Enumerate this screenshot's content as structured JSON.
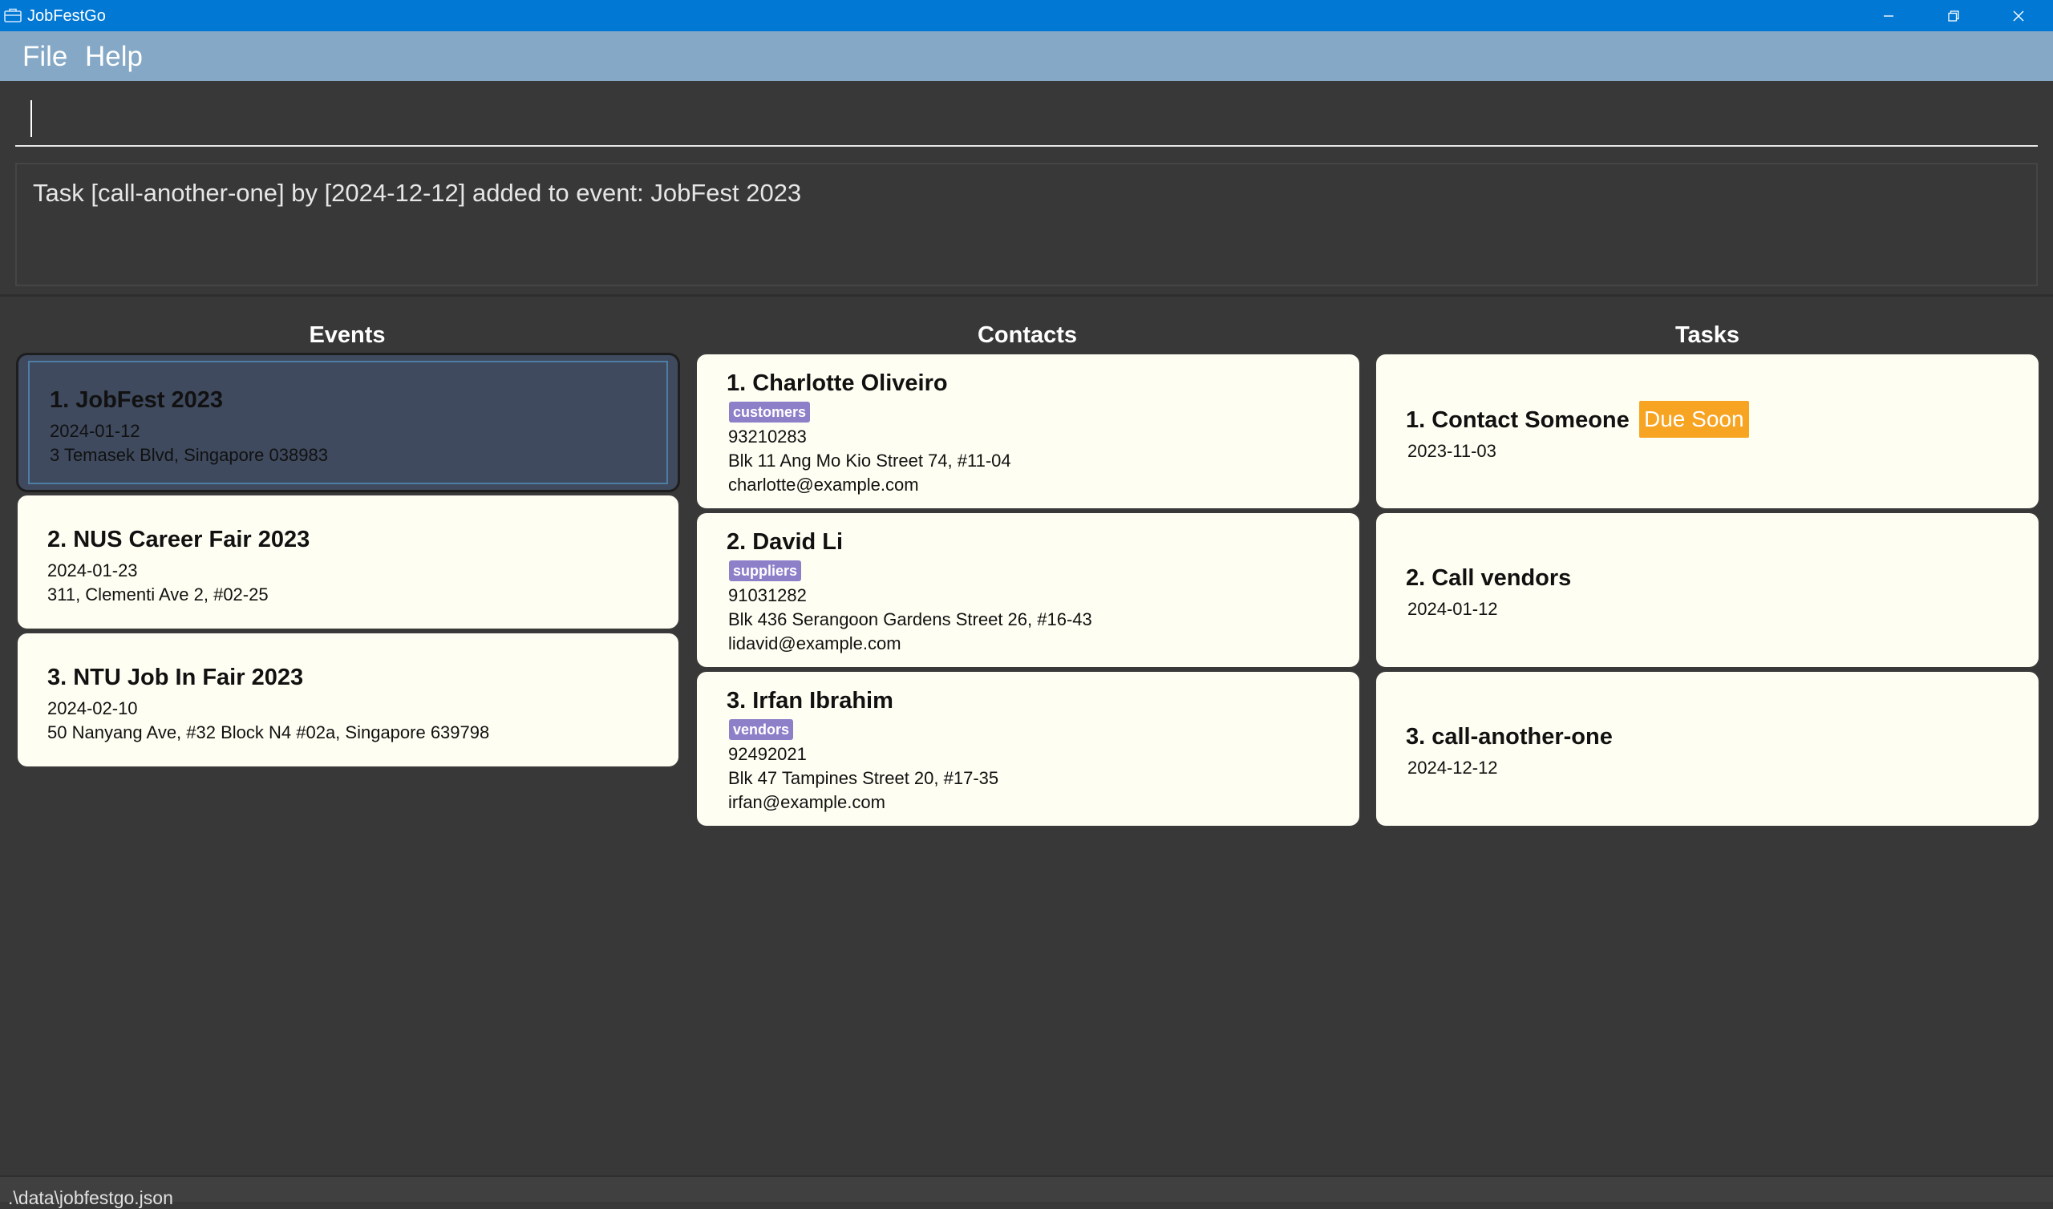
{
  "window": {
    "title": "JobFestGo"
  },
  "menu": {
    "file": "File",
    "help": "Help"
  },
  "command": {
    "value": ""
  },
  "result": {
    "text": "Task [call-another-one] by [2024-12-12] added to event: JobFest 2023"
  },
  "columns": {
    "events": "Events",
    "contacts": "Contacts",
    "tasks": "Tasks"
  },
  "events": [
    {
      "name": "1.  JobFest 2023",
      "date": "2024-01-12",
      "address": "3 Temasek Blvd, Singapore 038983",
      "selected": true
    },
    {
      "name": "2.  NUS Career Fair 2023",
      "date": "2024-01-23",
      "address": "311, Clementi Ave 2, #02-25",
      "selected": false
    },
    {
      "name": "3.  NTU Job In Fair 2023",
      "date": "2024-02-10",
      "address": "50 Nanyang Ave, #32 Block N4 #02a, Singapore 639798",
      "selected": false
    }
  ],
  "contacts": [
    {
      "name": "1.  Charlotte Oliveiro",
      "tag": "customers",
      "phone": "93210283",
      "address": "Blk 11 Ang Mo Kio Street 74, #11-04",
      "email": "charlotte@example.com"
    },
    {
      "name": "2.  David Li",
      "tag": "suppliers",
      "phone": "91031282",
      "address": "Blk 436 Serangoon Gardens Street 26, #16-43",
      "email": "lidavid@example.com"
    },
    {
      "name": "3.  Irfan Ibrahim",
      "tag": "vendors",
      "phone": "92492021",
      "address": "Blk 47 Tampines Street 20, #17-35",
      "email": "irfan@example.com"
    }
  ],
  "tasks": [
    {
      "name": "1.  Contact Someone",
      "date": "2023-11-03",
      "badge": "Due Soon"
    },
    {
      "name": "2.  Call vendors",
      "date": "2024-01-12",
      "badge": ""
    },
    {
      "name": "3.  call-another-one",
      "date": "2024-12-12",
      "badge": ""
    }
  ],
  "status": {
    "path": ".\\data\\jobfestgo.json"
  },
  "colors": {
    "titlebar": "#0078d4",
    "menubar": "#84a8c6",
    "background": "#383838",
    "card": "#fffef2",
    "selected_card": "#3f4a5e",
    "tag": "#8e7fc9",
    "due_soon": "#f7a422"
  },
  "icons": {
    "app": "briefcase-icon",
    "minimize": "minimize-icon",
    "restore": "restore-icon",
    "close": "close-icon"
  }
}
